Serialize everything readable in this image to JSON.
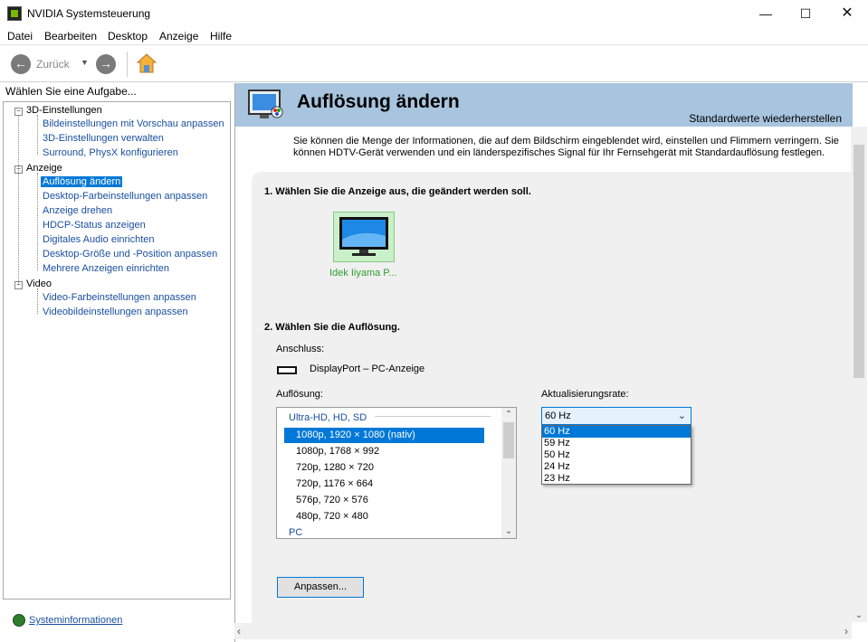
{
  "window": {
    "title": "NVIDIA Systemsteuerung",
    "minimize": "—",
    "maximize": "☐",
    "close": "✕"
  },
  "menu": [
    "Datei",
    "Bearbeiten",
    "Desktop",
    "Anzeige",
    "Hilfe"
  ],
  "toolbar": {
    "back_label": "Zurück"
  },
  "left": {
    "header": "Wählen Sie eine Aufgabe...",
    "categories": [
      {
        "label": "3D-Einstellungen",
        "items": [
          "Bildeinstellungen mit Vorschau anpassen",
          "3D-Einstellungen verwalten",
          "Surround, PhysX konfigurieren"
        ]
      },
      {
        "label": "Anzeige",
        "items": [
          "Auflösung ändern",
          "Desktop-Farbeinstellungen anpassen",
          "Anzeige drehen",
          "HDCP-Status anzeigen",
          "Digitales Audio einrichten",
          "Desktop-Größe und -Position anpassen",
          "Mehrere Anzeigen einrichten"
        ]
      },
      {
        "label": "Video",
        "items": [
          "Video-Farbeinstellungen anpassen",
          "Videobildeinstellungen anpassen"
        ]
      }
    ],
    "selected_item": "Auflösung ändern",
    "sysinfo": "Systeminformationen"
  },
  "main": {
    "title": "Auflösung ändern",
    "restore_defaults": "Standardwerte wiederherstellen",
    "description": "Sie können die Menge der Informationen, die auf dem Bildschirm eingeblendet wird, einstellen und Flimmern verringern. Sie können HDTV-Gerät verwenden und ein länderspezifisches Signal für Ihr Fernsehgerät mit Standardauflösung festlegen.",
    "step1": "1. Wählen Sie die Anzeige aus, die geändert werden soll.",
    "display_name": "Idek Iiyama P...",
    "step2": "2. Wählen Sie die Auflösung.",
    "connection_label": "Anschluss:",
    "connection_value": "DisplayPort – PC-Anzeige",
    "resolution_label": "Auflösung:",
    "refresh_label": "Aktualisierungsrate:",
    "resolution_group": "Ultra-HD, HD, SD",
    "resolution_group2": "PC",
    "resolutions": [
      "1080p, 1920 × 1080 (nativ)",
      "1080p, 1768 × 992",
      "720p, 1280 × 720",
      "720p, 1176 × 664",
      "576p, 720 × 576",
      "480p, 720 × 480"
    ],
    "selected_resolution": "1080p, 1920 × 1080 (nativ)",
    "refresh_value": "60 Hz",
    "refresh_options": [
      "60 Hz",
      "59 Hz",
      "50 Hz",
      "24 Hz",
      "23 Hz"
    ],
    "customize_button": "Anpassen..."
  },
  "colors": {
    "accent": "#0078d7",
    "banner": "#a8c4de",
    "nvidia_green": "#76b900",
    "link": "#1a4fa0"
  }
}
